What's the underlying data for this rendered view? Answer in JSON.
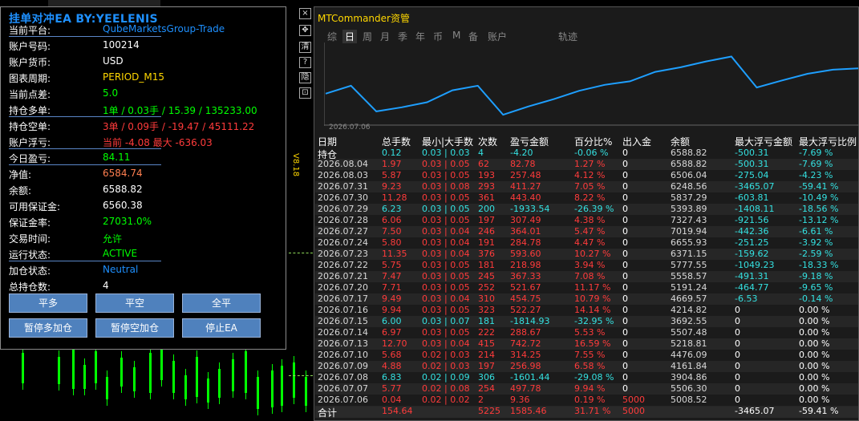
{
  "colors": {
    "accent": "#1e90ff",
    "red": "#ff3b3b",
    "green": "#00ff00",
    "cyan": "#34e1e1",
    "yellow": "#ffd700"
  },
  "left_panel": {
    "title": "挂单对冲EA BY:YEELENIS",
    "rows": [
      {
        "label": "当前平台:",
        "value": "QubeMarketsGroup-Trade",
        "color": "#1e90ff",
        "underline": true
      },
      {
        "label": "账户号码:",
        "value": "100214",
        "color": "#ffffff",
        "underline": false
      },
      {
        "label": "账户货币:",
        "value": "USD",
        "color": "#ffffff",
        "underline": false
      },
      {
        "label": "图表周期:",
        "value": "PERIOD_M15",
        "color": "#ffd700",
        "underline": false
      },
      {
        "label": "当前点差:",
        "value": "5.0",
        "color": "#00ff00",
        "underline": false
      },
      {
        "label": "持仓多单:",
        "value": "1单 / 0.03手 / 15.39 / 135233.00",
        "color": "#00ff00",
        "underline": true
      },
      {
        "label": "持仓空单:",
        "value": "3单 / 0.09手 / -19.47 / 45111.22",
        "color": "#ff3b3b",
        "underline": false
      },
      {
        "label": "账户浮亏:",
        "value": "当前 -4.08  最大 -636.03",
        "color": "#ff3b3b",
        "underline": true
      },
      {
        "label": "今日盈亏:",
        "value": "84.11",
        "color": "#00ff00",
        "underline": true
      },
      {
        "label": "净值:",
        "value": "6584.74",
        "color": "#ff7f50",
        "underline": false
      },
      {
        "label": "余额:",
        "value": "6588.82",
        "color": "#ffffff",
        "underline": false
      },
      {
        "label": "可用保证金:",
        "value": "6560.38",
        "color": "#ffffff",
        "underline": false
      },
      {
        "label": "保证金率:",
        "value": "27031.0%",
        "color": "#00ff00",
        "underline": false
      },
      {
        "label": "交易时间:",
        "value": "允许",
        "color": "#00ff00",
        "underline": false
      },
      {
        "label": "运行状态:",
        "value": "ACTIVE",
        "color": "#00ff00",
        "underline": true
      },
      {
        "label": "加仓状态:",
        "value": "Neutral",
        "color": "#1e90ff",
        "underline": false
      },
      {
        "label": "总持仓数:",
        "value": "4",
        "color": "#ffffff",
        "underline": false
      }
    ],
    "buttons": [
      {
        "label": "平多",
        "name": "close-long-button"
      },
      {
        "label": "平空",
        "name": "close-short-button"
      },
      {
        "label": "全平",
        "name": "close-all-button"
      },
      {
        "label": "暂停多加仓",
        "name": "pause-long-add-button"
      },
      {
        "label": "暂停空加仓",
        "name": "pause-short-add-button"
      },
      {
        "label": "停止EA",
        "name": "stop-ea-button"
      }
    ]
  },
  "toolbar": {
    "icons": [
      "close-icon",
      "move-icon",
      "clear-icon",
      "help-icon",
      "hide-icon",
      "restore-icon"
    ],
    "labels": [
      "×",
      "✥",
      "清",
      "?",
      "隐",
      "⊡"
    ]
  },
  "right_panel": {
    "title": "MTCommander资管",
    "tabs": [
      "综",
      "日",
      "周",
      "月",
      "季",
      "年",
      "币",
      "M",
      "备",
      "账户",
      "轨迹"
    ],
    "active_tab": "日",
    "vertical_label": "V8.18",
    "chart_x_label": "2026.07.06",
    "headers": [
      "日期",
      "总手数",
      "最小|大手数",
      "次数",
      "盈亏金额",
      "百分比%",
      "出入金",
      "余额",
      "最大浮亏金额",
      "最大浮亏比例"
    ],
    "rows": [
      {
        "c": [
          "持仓",
          "0.12",
          "0.03 | 0.03",
          "4",
          "-4.20",
          "-0.06 %",
          "0",
          "6588.82",
          "-500.31",
          "-7.69 %"
        ],
        "t": "hold"
      },
      {
        "c": [
          "2026.08.04",
          "1.97",
          "0.03 | 0.05",
          "62",
          "82.78",
          "1.27 %",
          "0",
          "6588.82",
          "-500.31",
          "-7.69 %"
        ],
        "t": "pos"
      },
      {
        "c": [
          "2026.08.03",
          "5.87",
          "0.03 | 0.05",
          "193",
          "257.48",
          "4.12 %",
          "0",
          "6506.04",
          "-275.04",
          "-4.23 %"
        ],
        "t": "pos"
      },
      {
        "c": [
          "2026.07.31",
          "9.23",
          "0.03 | 0.08",
          "293",
          "411.27",
          "7.05 %",
          "0",
          "6248.56",
          "-3465.07",
          "-59.41 %"
        ],
        "t": "pos"
      },
      {
        "c": [
          "2026.07.30",
          "11.28",
          "0.03 | 0.05",
          "361",
          "443.40",
          "8.22 %",
          "0",
          "5837.29",
          "-603.81",
          "-10.49 %"
        ],
        "t": "pos"
      },
      {
        "c": [
          "2026.07.29",
          "6.23",
          "0.03 | 0.05",
          "200",
          "-1933.54",
          "-26.39 %",
          "0",
          "5393.89",
          "-1408.11",
          "-18.56 %"
        ],
        "t": "neg"
      },
      {
        "c": [
          "2026.07.28",
          "6.06",
          "0.03 | 0.05",
          "197",
          "307.49",
          "4.38 %",
          "0",
          "7327.43",
          "-921.56",
          "-13.12 %"
        ],
        "t": "pos"
      },
      {
        "c": [
          "2026.07.27",
          "7.50",
          "0.03 | 0.04",
          "246",
          "364.01",
          "5.47 %",
          "0",
          "7019.94",
          "-442.36",
          "-6.61 %"
        ],
        "t": "pos"
      },
      {
        "c": [
          "2026.07.24",
          "5.80",
          "0.03 | 0.04",
          "191",
          "284.78",
          "4.47 %",
          "0",
          "6655.93",
          "-251.25",
          "-3.92 %"
        ],
        "t": "pos"
      },
      {
        "c": [
          "2026.07.23",
          "11.35",
          "0.03 | 0.04",
          "376",
          "593.60",
          "10.27 %",
          "0",
          "6371.15",
          "-159.62",
          "-2.59 %"
        ],
        "t": "pos"
      },
      {
        "c": [
          "2026.07.22",
          "5.75",
          "0.03 | 0.05",
          "181",
          "218.98",
          "3.94 %",
          "0",
          "5777.55",
          "-1049.23",
          "-18.33 %"
        ],
        "t": "pos"
      },
      {
        "c": [
          "2026.07.21",
          "7.47",
          "0.03 | 0.05",
          "245",
          "367.33",
          "7.08 %",
          "0",
          "5558.57",
          "-491.31",
          "-9.18 %"
        ],
        "t": "pos"
      },
      {
        "c": [
          "2026.07.20",
          "7.71",
          "0.03 | 0.05",
          "252",
          "521.67",
          "11.17 %",
          "0",
          "5191.24",
          "-464.77",
          "-9.65 %"
        ],
        "t": "pos"
      },
      {
        "c": [
          "2026.07.17",
          "9.49",
          "0.03 | 0.04",
          "310",
          "454.75",
          "10.79 %",
          "0",
          "4669.57",
          "-6.53",
          "-0.14 %"
        ],
        "t": "pos"
      },
      {
        "c": [
          "2026.07.16",
          "9.94",
          "0.03 | 0.05",
          "323",
          "522.27",
          "14.14 %",
          "0",
          "4214.82",
          "0",
          "0.00 %"
        ],
        "t": "pos"
      },
      {
        "c": [
          "2026.07.15",
          "6.00",
          "0.03 | 0.07",
          "181",
          "-1814.93",
          "-32.95 %",
          "0",
          "3692.55",
          "0",
          "0.00 %"
        ],
        "t": "neg"
      },
      {
        "c": [
          "2026.07.14",
          "6.97",
          "0.03 | 0.05",
          "222",
          "288.67",
          "5.53 %",
          "0",
          "5507.48",
          "0",
          "0.00 %"
        ],
        "t": "pos"
      },
      {
        "c": [
          "2026.07.13",
          "12.70",
          "0.03 | 0.04",
          "415",
          "742.72",
          "16.59 %",
          "0",
          "5218.81",
          "0",
          "0.00 %"
        ],
        "t": "pos"
      },
      {
        "c": [
          "2026.07.10",
          "5.68",
          "0.02 | 0.03",
          "214",
          "314.25",
          "7.55 %",
          "0",
          "4476.09",
          "0",
          "0.00 %"
        ],
        "t": "pos"
      },
      {
        "c": [
          "2026.07.09",
          "4.88",
          "0.02 | 0.03",
          "197",
          "256.98",
          "6.58 %",
          "0",
          "4161.84",
          "0",
          "0.00 %"
        ],
        "t": "pos"
      },
      {
        "c": [
          "2026.07.08",
          "6.83",
          "0.02 | 0.09",
          "306",
          "-1601.44",
          "-29.08 %",
          "0",
          "3904.86",
          "0",
          "0.00 %"
        ],
        "t": "neg"
      },
      {
        "c": [
          "2026.07.07",
          "5.77",
          "0.02 | 0.08",
          "254",
          "497.78",
          "9.94 %",
          "0",
          "5506.30",
          "0",
          "0.00 %"
        ],
        "t": "pos"
      },
      {
        "c": [
          "2026.07.06",
          "0.04",
          "0.02 | 0.02",
          "2",
          "9.36",
          "0.19 %",
          "5000",
          "5008.52",
          "0",
          "0.00 %"
        ],
        "t": "pos"
      },
      {
        "c": [
          "合计",
          "154.64",
          "",
          "5225",
          "1585.46",
          "31.71 %",
          "5000",
          "",
          "-3465.07",
          "-59.41 %"
        ],
        "t": "total"
      }
    ],
    "equity_chart_data": {
      "type": "line",
      "x": [
        "2026.07.06",
        "2026.07.07",
        "2026.07.08",
        "2026.07.09",
        "2026.07.10",
        "2026.07.13",
        "2026.07.14",
        "2026.07.15",
        "2026.07.16",
        "2026.07.17",
        "2026.07.20",
        "2026.07.21",
        "2026.07.22",
        "2026.07.23",
        "2026.07.24",
        "2026.07.27",
        "2026.07.28",
        "2026.07.29",
        "2026.07.30",
        "2026.07.31",
        "2026.08.03",
        "2026.08.04"
      ],
      "y": [
        5008.52,
        5506.3,
        3904.86,
        4161.84,
        4476.09,
        5218.81,
        5507.48,
        3692.55,
        4214.82,
        4669.57,
        5191.24,
        5558.57,
        5777.55,
        6371.15,
        6655.93,
        7019.94,
        7327.43,
        5393.89,
        5837.29,
        6248.56,
        6506.04,
        6588.82
      ]
    }
  }
}
